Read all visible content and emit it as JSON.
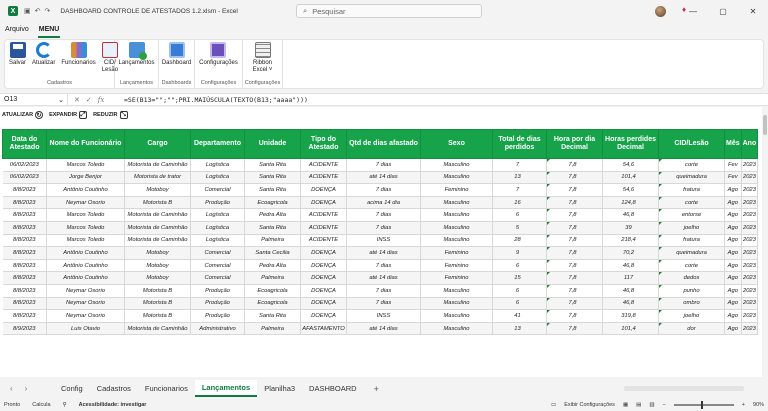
{
  "window": {
    "title": "DASHBOARD CONTROLE DE ATESTADOS 1.2.xlsm  -  Excel",
    "search_placeholder": "Pesquisar",
    "minimize": "—",
    "restore": "▢",
    "close": "✕"
  },
  "ribbon_tabs": [
    "Arquivo",
    "MENU"
  ],
  "ribbon_groups": [
    {
      "label": "Cadastros",
      "buttons": [
        "Salvar",
        "Atualizar",
        "Funcionarios",
        "CID/\nLesão"
      ]
    },
    {
      "label": "Lançamentos",
      "buttons": [
        "Lançamentos"
      ]
    },
    {
      "label": "Dashboards",
      "buttons": [
        "Dashboard"
      ]
    },
    {
      "label": "Configurações",
      "buttons": [
        "Configurações"
      ]
    },
    {
      "label": "Configurações",
      "buttons": [
        "Ribbon\nExcel ˅"
      ]
    }
  ],
  "formula_bar": {
    "name_box": "O13",
    "fx": "fx",
    "formula": "=SE(B13=\"\";\"\";PRI.MAIÚSCULA(TEXTO(B13;\"aaaa\")))"
  },
  "sheet_tools": {
    "atualizar": "ATUALIZAR",
    "expandir": "EXPANDIR",
    "reduzir": "REDUZIR"
  },
  "table": {
    "headers": [
      "Data do Atestado",
      "Nome do Funcionário",
      "Cargo",
      "Departamento",
      "Unidade",
      "Tipo do Atestado",
      "Qtd de dias afastado",
      "Sexo",
      "Total de dias perdidos",
      "Hora por dia Decimal",
      "Horas perdides Decimal",
      "CID/Lesão",
      "Mês",
      "Ano"
    ],
    "rows": [
      [
        "06/02/2023",
        "Marcos Toledo",
        "Motorista de Caminhão",
        "Logística",
        "Santa Rita",
        "ACIDENTE",
        "7 dias",
        "Masculino",
        "7",
        "7,8",
        "54,6",
        "corte",
        "Fev",
        "2023"
      ],
      [
        "06/02/2023",
        "Jorge Benjor",
        "Motorista de trator",
        "Logística",
        "Santa Rita",
        "ACIDENTE",
        "até 14 dias",
        "Masculino",
        "13",
        "7,8",
        "101,4",
        "queimadura",
        "Fev",
        "2023"
      ],
      [
        "8/8/2023",
        "Antônio Coutinho",
        "Motoboy",
        "Comercial",
        "Santa Rita",
        "DOENÇA",
        "7 dias",
        "Feminino",
        "7",
        "7,8",
        "54,6",
        "fratura",
        "Ago",
        "2023"
      ],
      [
        "8/8/2023",
        "Neymar Osorio",
        "Motorista B",
        "Produção",
        "Ecoagricola",
        "DOENÇA",
        "acima 14 dia",
        "Masculino",
        "16",
        "7,8",
        "124,8",
        "corte",
        "Ago",
        "2023"
      ],
      [
        "8/8/2023",
        "Marcos Toledo",
        "Motorista de Caminhão",
        "Logística",
        "Pedra Alta",
        "ACIDENTE",
        "7 dias",
        "Masculino",
        "6",
        "7,8",
        "46,8",
        "entorse",
        "Ago",
        "2023"
      ],
      [
        "8/8/2023",
        "Marcos Toledo",
        "Motorista de Caminhão",
        "Logística",
        "Santa Rita",
        "ACIDENTE",
        "7 dias",
        "Masculino",
        "5",
        "7,8",
        "39",
        "joelho",
        "Ago",
        "2023"
      ],
      [
        "8/8/2023",
        "Marcos Toledo",
        "Motorista de Caminhão",
        "Logística",
        "Palmeira",
        "ACIDENTE",
        "INSS",
        "Masculino",
        "28",
        "7,8",
        "218,4",
        "fratura",
        "Ago",
        "2023"
      ],
      [
        "8/8/2023",
        "Antônio Coutinho",
        "Motoboy",
        "Comercial",
        "Santa Cecilia",
        "DOENÇA",
        "até 14 dias",
        "Feminino",
        "9",
        "7,8",
        "70,2",
        "queimadura",
        "Ago",
        "2023"
      ],
      [
        "8/8/2023",
        "Antônio Coutinho",
        "Motoboy",
        "Comercial",
        "Pedra Alta",
        "DOENÇA",
        "7 dias",
        "Feminino",
        "6",
        "7,8",
        "46,8",
        "corte",
        "Ago",
        "2023"
      ],
      [
        "8/8/2023",
        "Antônio Coutinho",
        "Motoboy",
        "Comercial",
        "Palmeira",
        "DOENÇA",
        "até 14 dias",
        "Feminino",
        "15",
        "7,8",
        "117",
        "dedos",
        "Ago",
        "2023"
      ],
      [
        "8/8/2023",
        "Neymar Osorio",
        "Motorista B",
        "Produção",
        "Ecoagricola",
        "DOENÇA",
        "7 dias",
        "Masculino",
        "6",
        "7,8",
        "46,8",
        "punho",
        "Ago",
        "2023"
      ],
      [
        "8/8/2023",
        "Neymar Osorio",
        "Motorista B",
        "Produção",
        "Ecoagricola",
        "DOENÇA",
        "7 dias",
        "Masculino",
        "6",
        "7,8",
        "46,8",
        "ombro",
        "Ago",
        "2023"
      ],
      [
        "8/8/2023",
        "Neymar Osorio",
        "Motorista B",
        "Produção",
        "Santa Rita",
        "DOENÇA",
        "INSS",
        "Masculino",
        "41",
        "7,8",
        "319,8",
        "joelho",
        "Ago",
        "2023"
      ],
      [
        "8/9/2023",
        "Luis Otavio",
        "Motorista de Caminhão",
        "Administrativo",
        "Palmeira",
        "AFASTAMENTO",
        "até 14 dias",
        "Masculino",
        "13",
        "7,8",
        "101,4",
        "dor",
        "Ago",
        "2023"
      ]
    ]
  },
  "sheet_tabs": [
    "Config",
    "Cadastros",
    "Funcionarios",
    "Lançamentos",
    "Planilha3",
    "DASHBOARD"
  ],
  "active_sheet": "Lançamentos",
  "status": {
    "mode": "Pronto",
    "calc": "Calcula",
    "accessibility": "Acessibilidade: investigar",
    "display_settings": "Exibir Configurações",
    "zoom": "90%"
  },
  "colors": {
    "header_green": "#16a34a",
    "excel_green": "#107c41"
  }
}
